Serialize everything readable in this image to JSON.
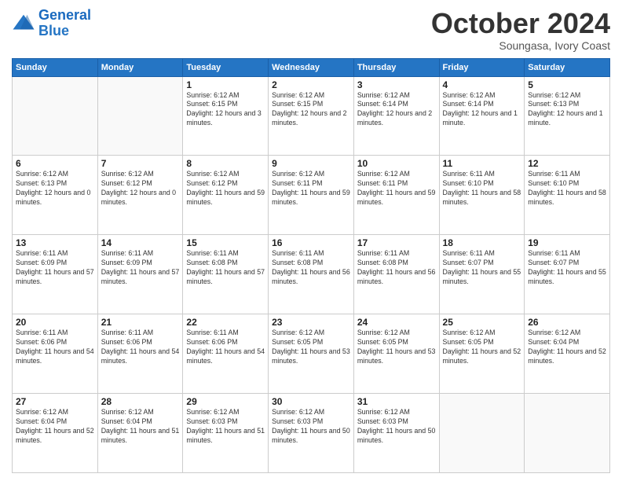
{
  "header": {
    "logo_line1": "General",
    "logo_line2": "Blue",
    "month": "October 2024",
    "location": "Soungasa, Ivory Coast"
  },
  "days_of_week": [
    "Sunday",
    "Monday",
    "Tuesday",
    "Wednesday",
    "Thursday",
    "Friday",
    "Saturday"
  ],
  "weeks": [
    [
      {
        "day": "",
        "sunrise": "",
        "sunset": "",
        "daylight": ""
      },
      {
        "day": "",
        "sunrise": "",
        "sunset": "",
        "daylight": ""
      },
      {
        "day": "1",
        "sunrise": "Sunrise: 6:12 AM",
        "sunset": "Sunset: 6:15 PM",
        "daylight": "Daylight: 12 hours and 3 minutes."
      },
      {
        "day": "2",
        "sunrise": "Sunrise: 6:12 AM",
        "sunset": "Sunset: 6:15 PM",
        "daylight": "Daylight: 12 hours and 2 minutes."
      },
      {
        "day": "3",
        "sunrise": "Sunrise: 6:12 AM",
        "sunset": "Sunset: 6:14 PM",
        "daylight": "Daylight: 12 hours and 2 minutes."
      },
      {
        "day": "4",
        "sunrise": "Sunrise: 6:12 AM",
        "sunset": "Sunset: 6:14 PM",
        "daylight": "Daylight: 12 hours and 1 minute."
      },
      {
        "day": "5",
        "sunrise": "Sunrise: 6:12 AM",
        "sunset": "Sunset: 6:13 PM",
        "daylight": "Daylight: 12 hours and 1 minute."
      }
    ],
    [
      {
        "day": "6",
        "sunrise": "Sunrise: 6:12 AM",
        "sunset": "Sunset: 6:13 PM",
        "daylight": "Daylight: 12 hours and 0 minutes."
      },
      {
        "day": "7",
        "sunrise": "Sunrise: 6:12 AM",
        "sunset": "Sunset: 6:12 PM",
        "daylight": "Daylight: 12 hours and 0 minutes."
      },
      {
        "day": "8",
        "sunrise": "Sunrise: 6:12 AM",
        "sunset": "Sunset: 6:12 PM",
        "daylight": "Daylight: 11 hours and 59 minutes."
      },
      {
        "day": "9",
        "sunrise": "Sunrise: 6:12 AM",
        "sunset": "Sunset: 6:11 PM",
        "daylight": "Daylight: 11 hours and 59 minutes."
      },
      {
        "day": "10",
        "sunrise": "Sunrise: 6:12 AM",
        "sunset": "Sunset: 6:11 PM",
        "daylight": "Daylight: 11 hours and 59 minutes."
      },
      {
        "day": "11",
        "sunrise": "Sunrise: 6:11 AM",
        "sunset": "Sunset: 6:10 PM",
        "daylight": "Daylight: 11 hours and 58 minutes."
      },
      {
        "day": "12",
        "sunrise": "Sunrise: 6:11 AM",
        "sunset": "Sunset: 6:10 PM",
        "daylight": "Daylight: 11 hours and 58 minutes."
      }
    ],
    [
      {
        "day": "13",
        "sunrise": "Sunrise: 6:11 AM",
        "sunset": "Sunset: 6:09 PM",
        "daylight": "Daylight: 11 hours and 57 minutes."
      },
      {
        "day": "14",
        "sunrise": "Sunrise: 6:11 AM",
        "sunset": "Sunset: 6:09 PM",
        "daylight": "Daylight: 11 hours and 57 minutes."
      },
      {
        "day": "15",
        "sunrise": "Sunrise: 6:11 AM",
        "sunset": "Sunset: 6:08 PM",
        "daylight": "Daylight: 11 hours and 57 minutes."
      },
      {
        "day": "16",
        "sunrise": "Sunrise: 6:11 AM",
        "sunset": "Sunset: 6:08 PM",
        "daylight": "Daylight: 11 hours and 56 minutes."
      },
      {
        "day": "17",
        "sunrise": "Sunrise: 6:11 AM",
        "sunset": "Sunset: 6:08 PM",
        "daylight": "Daylight: 11 hours and 56 minutes."
      },
      {
        "day": "18",
        "sunrise": "Sunrise: 6:11 AM",
        "sunset": "Sunset: 6:07 PM",
        "daylight": "Daylight: 11 hours and 55 minutes."
      },
      {
        "day": "19",
        "sunrise": "Sunrise: 6:11 AM",
        "sunset": "Sunset: 6:07 PM",
        "daylight": "Daylight: 11 hours and 55 minutes."
      }
    ],
    [
      {
        "day": "20",
        "sunrise": "Sunrise: 6:11 AM",
        "sunset": "Sunset: 6:06 PM",
        "daylight": "Daylight: 11 hours and 54 minutes."
      },
      {
        "day": "21",
        "sunrise": "Sunrise: 6:11 AM",
        "sunset": "Sunset: 6:06 PM",
        "daylight": "Daylight: 11 hours and 54 minutes."
      },
      {
        "day": "22",
        "sunrise": "Sunrise: 6:11 AM",
        "sunset": "Sunset: 6:06 PM",
        "daylight": "Daylight: 11 hours and 54 minutes."
      },
      {
        "day": "23",
        "sunrise": "Sunrise: 6:12 AM",
        "sunset": "Sunset: 6:05 PM",
        "daylight": "Daylight: 11 hours and 53 minutes."
      },
      {
        "day": "24",
        "sunrise": "Sunrise: 6:12 AM",
        "sunset": "Sunset: 6:05 PM",
        "daylight": "Daylight: 11 hours and 53 minutes."
      },
      {
        "day": "25",
        "sunrise": "Sunrise: 6:12 AM",
        "sunset": "Sunset: 6:05 PM",
        "daylight": "Daylight: 11 hours and 52 minutes."
      },
      {
        "day": "26",
        "sunrise": "Sunrise: 6:12 AM",
        "sunset": "Sunset: 6:04 PM",
        "daylight": "Daylight: 11 hours and 52 minutes."
      }
    ],
    [
      {
        "day": "27",
        "sunrise": "Sunrise: 6:12 AM",
        "sunset": "Sunset: 6:04 PM",
        "daylight": "Daylight: 11 hours and 52 minutes."
      },
      {
        "day": "28",
        "sunrise": "Sunrise: 6:12 AM",
        "sunset": "Sunset: 6:04 PM",
        "daylight": "Daylight: 11 hours and 51 minutes."
      },
      {
        "day": "29",
        "sunrise": "Sunrise: 6:12 AM",
        "sunset": "Sunset: 6:03 PM",
        "daylight": "Daylight: 11 hours and 51 minutes."
      },
      {
        "day": "30",
        "sunrise": "Sunrise: 6:12 AM",
        "sunset": "Sunset: 6:03 PM",
        "daylight": "Daylight: 11 hours and 50 minutes."
      },
      {
        "day": "31",
        "sunrise": "Sunrise: 6:12 AM",
        "sunset": "Sunset: 6:03 PM",
        "daylight": "Daylight: 11 hours and 50 minutes."
      },
      {
        "day": "",
        "sunrise": "",
        "sunset": "",
        "daylight": ""
      },
      {
        "day": "",
        "sunrise": "",
        "sunset": "",
        "daylight": ""
      }
    ]
  ]
}
